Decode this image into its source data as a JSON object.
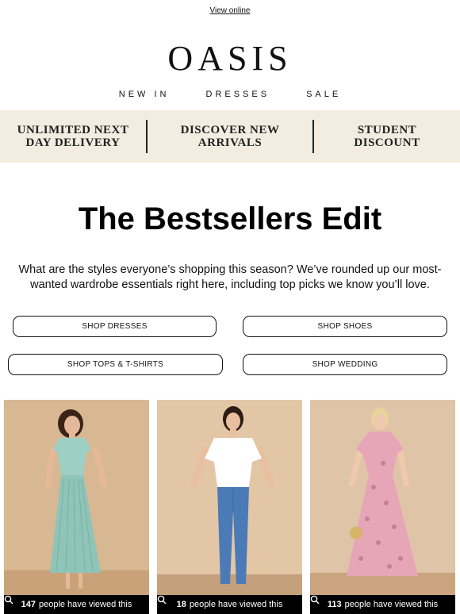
{
  "header": {
    "view_online": "View online",
    "logo": "OASIS",
    "nav": [
      "NEW IN",
      "DRESSES",
      "SALE"
    ]
  },
  "banner": {
    "items": [
      [
        "UNLIMITED NEXT",
        "DAY DELIVERY"
      ],
      [
        "DISCOVER NEW",
        "ARRIVALS"
      ],
      [
        "STUDENT",
        "DISCOUNT"
      ]
    ]
  },
  "main": {
    "headline": "The Bestsellers Edit",
    "intro": "What are the styles everyone’s shopping this season? We’ve rounded up our most-wanted wardrobe essentials right here, including top picks we know you’ll love.",
    "buttons": [
      "SHOP DRESSES",
      "SHOP SHOES",
      "SHOP TOPS & T-SHIRTS",
      "SHOP WEDDING"
    ]
  },
  "products": [
    {
      "views": "147",
      "views_suffix": "people have viewed this",
      "dress_color": "#9ecfc4"
    },
    {
      "views": "18",
      "views_suffix": "people have viewed this",
      "top_color": "#ffffff",
      "jeans_color": "#4a7bb6"
    },
    {
      "views": "113",
      "views_suffix": "people have viewed this",
      "dress_color": "#e6a6b8"
    }
  ]
}
